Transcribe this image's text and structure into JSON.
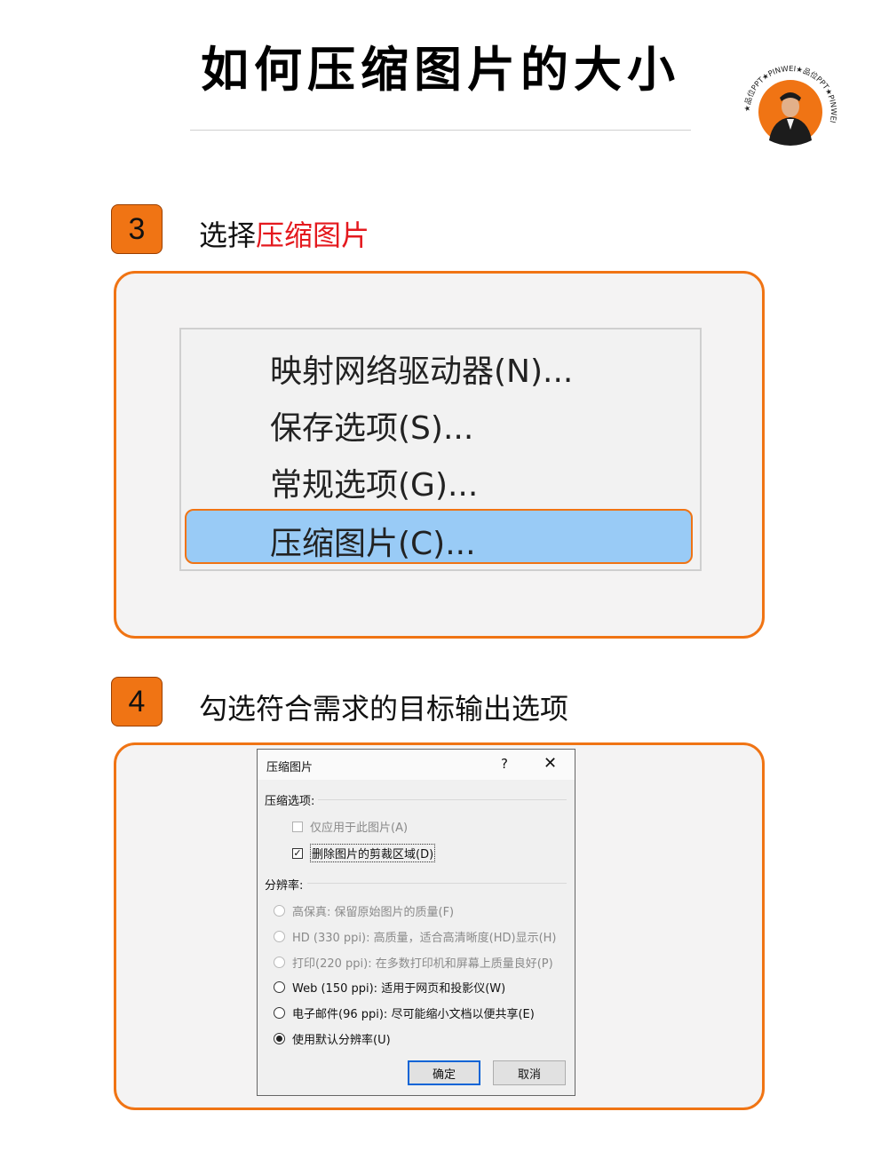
{
  "page": {
    "title": "如何压缩图片的大小",
    "logo_text": "★品位PPT★PINWEI★品位PPT★PINWEI"
  },
  "step3": {
    "number": "3",
    "text_prefix": "选择",
    "text_highlight": "压缩图片"
  },
  "context_menu": {
    "items": [
      {
        "label": "映射网络驱动器(N)..."
      },
      {
        "label": "保存选项(S)..."
      },
      {
        "label": "常规选项(G)..."
      },
      {
        "label": "压缩图片(C)...",
        "selected": true
      }
    ]
  },
  "step4": {
    "number": "4",
    "text": "勾选符合需求的目标输出选项"
  },
  "dialog": {
    "title": "压缩图片",
    "help": "?",
    "close": "✕",
    "compress_group": "压缩选项:",
    "checkbox_apply_only": {
      "label": "仅应用于此图片(A)",
      "checked": false,
      "disabled": true
    },
    "checkbox_delete_crop": {
      "label": "删除图片的剪裁区域(D)",
      "checked": true,
      "disabled": false
    },
    "resolution_group": "分辨率:",
    "resolution_options": [
      {
        "label": "高保真: 保留原始图片的质量(F)",
        "selected": false,
        "disabled": true
      },
      {
        "label": "HD (330 ppi): 高质量，适合高清晰度(HD)显示(H)",
        "selected": false,
        "disabled": true
      },
      {
        "label": "打印(220 ppi): 在多数打印机和屏幕上质量良好(P)",
        "selected": false,
        "disabled": true
      },
      {
        "label": "Web (150 ppi): 适用于网页和投影仪(W)",
        "selected": false,
        "disabled": false
      },
      {
        "label": "电子邮件(96 ppi): 尽可能缩小文档以便共享(E)",
        "selected": false,
        "disabled": false
      },
      {
        "label": "使用默认分辨率(U)",
        "selected": true,
        "disabled": false
      }
    ],
    "ok_label": "确定",
    "cancel_label": "取消"
  },
  "colors": {
    "accent_orange": "#f07414",
    "highlight_red": "#e4191e",
    "menu_selection": "#99cbf6"
  }
}
